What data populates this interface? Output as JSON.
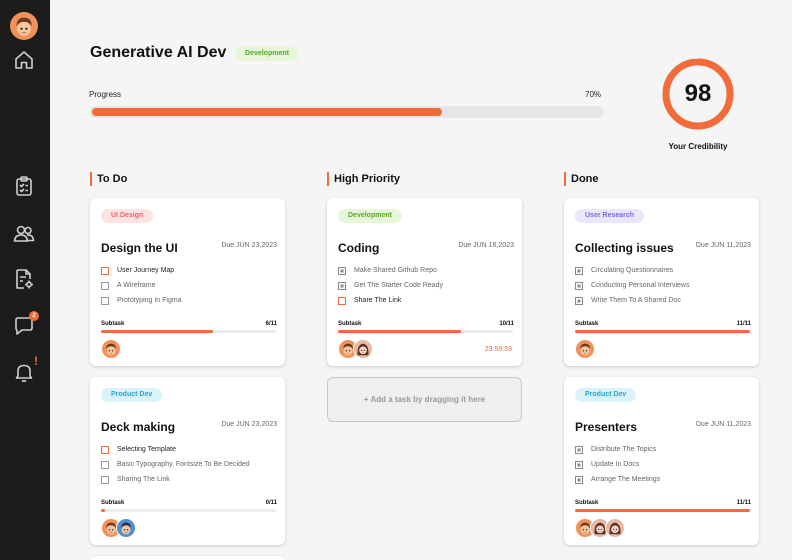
{
  "sidebar": {
    "nav_items": [
      {
        "icon": "home-icon"
      },
      {
        "icon": "clipboard-list-icon"
      },
      {
        "icon": "users-icon"
      },
      {
        "icon": "document-settings-icon"
      },
      {
        "icon": "chat-bubble-icon",
        "badge": "2"
      },
      {
        "icon": "bell-icon",
        "alert": "!"
      }
    ]
  },
  "project": {
    "title": "Generative AI Dev",
    "tag": "Development",
    "progress_label": "Progress",
    "progress_text": "70%",
    "progress": 0.7
  },
  "credibility": {
    "value": "98",
    "score": 0.98,
    "label": "Your Credibility"
  },
  "colors": {
    "accent": "#f26b3a",
    "sidebar": "#1c1c1c",
    "background": "#f5f5f5"
  },
  "columns": [
    {
      "title": "To Do",
      "cards": [
        {
          "tag": "UI Design",
          "title": "Design the UI",
          "due": "Due   JUN 23,2023",
          "tasks": [
            "User Journey Map",
            "A Wireframe",
            "Prototyping In Figma"
          ],
          "subtask_label": "Subtask",
          "subtask_count": "6/11",
          "subtask_progress": 0.64
        },
        {
          "tag": "Product Dev",
          "title": "Deck making",
          "due": "Due   JUN 23,2023",
          "tasks": [
            "Selecting Template",
            "Basic Typography, Fontsize To Be Decided",
            "Sharing The Link"
          ],
          "subtask_label": "Subtask",
          "subtask_count": "0/11",
          "subtask_progress": 0.02
        }
      ]
    },
    {
      "title": "High Priority",
      "cards": [
        {
          "tag": "Development",
          "title": "Coding",
          "due": "Due   JUN 16,2023",
          "tasks": [
            "Make Shared Github Repo",
            "Get The Starter Code Ready",
            "Share The Link"
          ],
          "subtask_label": "Subtask",
          "subtask_count": "10/11",
          "subtask_progress": 0.7,
          "timer": "23:59:59"
        }
      ],
      "drop_zone": "+ Add a task by dragging it here"
    },
    {
      "title": "Done",
      "cards": [
        {
          "tag": "User Research",
          "title": "Collecting issues",
          "due": "Due   JUN 11,2023",
          "tasks": [
            "Circulating Questionnaires",
            "Conducting Personal Interviews",
            "Write Them To A Shared Doc"
          ],
          "subtask_label": "Subtask",
          "subtask_count": "11/11",
          "subtask_progress": 1.0
        },
        {
          "tag": "Product Dev",
          "title": "Presenters",
          "due": "Due   JUN 11,2023",
          "tasks": [
            "Distribute The Topics",
            "Update In Docs",
            "Arrange The Meetings"
          ],
          "subtask_label": "Subtask",
          "subtask_count": "11/11",
          "subtask_progress": 1.0
        }
      ]
    }
  ]
}
